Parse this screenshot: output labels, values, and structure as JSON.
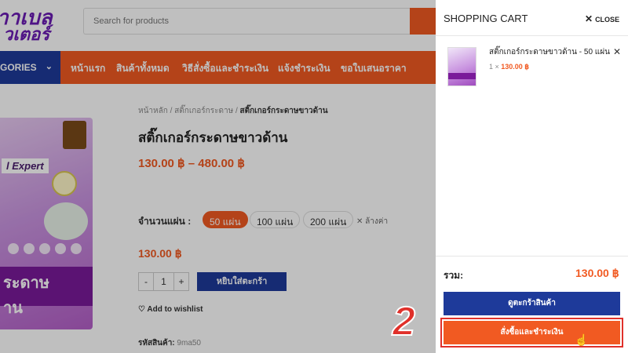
{
  "header": {
    "logo_line1": "าาเบล",
    "logo_line2": "วเตอร์",
    "search_placeholder": "Search for products"
  },
  "nav": {
    "categories_label": "GORIES",
    "items": [
      "หน้าแรก",
      "สินค้าทั้งหมด",
      "วิธีสั่งซื้อและชำระเงิน",
      "แจ้งชำระเงิน",
      "ขอใบเสนอราคา"
    ]
  },
  "product": {
    "image_text_1": "l Expert",
    "image_text_2": "ระดาษ",
    "image_text_3": "าน",
    "breadcrumb": [
      "หน้าหลัก",
      "สติ๊กเกอร์กระดาษ",
      "สติ๊กเกอร์กระดาษขาวด้าน"
    ],
    "breadcrumb_sep": "/",
    "title": "สติ๊กเกอร์กระดาษขาวด้าน",
    "price_range": "130.00 ฿ – 480.00 ฿",
    "qty_label": "จำนวนแผ่น :",
    "options": [
      "50 แผ่น",
      "100 แผ่น",
      "200 แผ่น"
    ],
    "selected_option_index": 0,
    "clear_label": "ล้างค่า",
    "selected_price": "130.00 ฿",
    "quantity": "1",
    "minus": "-",
    "plus": "+",
    "add_to_cart": "หยิบใส่ตะกร้า",
    "wishlist": "Add to wishlist",
    "sku_label": "รหัสสินค้า:",
    "sku_value": "9ma50"
  },
  "cart": {
    "title": "SHOPPING CART",
    "close_label": "CLOSE",
    "item": {
      "name": "สติ๊กเกอร์กระดาษขาวด้าน - 50 แผ่น",
      "qty_prefix": "1 ×",
      "price": "130.00 ฿"
    },
    "subtotal_label": "รวม:",
    "subtotal_value": "130.00 ฿",
    "view_cart": "ดูตะกร้าสินค้า",
    "checkout": "สั่งซื้อและชำระเงิน"
  },
  "annotation": {
    "step_number": "2"
  },
  "colors": {
    "brand_orange": "#f15a22",
    "brand_blue": "#1e3a9a",
    "highlight_red": "#e0302a"
  }
}
